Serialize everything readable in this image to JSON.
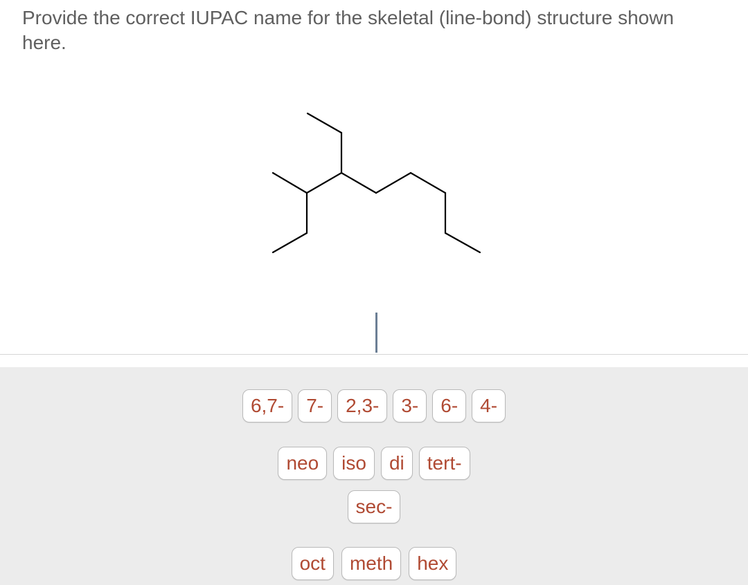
{
  "question": {
    "text": "Provide the correct IUPAC name for the skeletal (line-bond) structure shown here."
  },
  "structure": {
    "description": "skeletal line-bond structure of a branched alkane",
    "bond_color": "#000000"
  },
  "answer": {
    "value": ""
  },
  "tiles": {
    "row1": [
      {
        "label": "6,7-"
      },
      {
        "label": "7-"
      },
      {
        "label": "2,3-"
      },
      {
        "label": "3-"
      },
      {
        "label": "6-"
      },
      {
        "label": "4-"
      }
    ],
    "row2": [
      {
        "label": "neo"
      },
      {
        "label": "iso"
      },
      {
        "label": "di"
      },
      {
        "label": "tert-"
      }
    ],
    "row3": [
      {
        "label": "sec-"
      }
    ],
    "row4": [
      {
        "label": "oct"
      },
      {
        "label": "meth"
      },
      {
        "label": "hex"
      }
    ]
  },
  "colors": {
    "tile_text": "#b04a33",
    "tray_background": "#ececec",
    "question_text": "#5f5f5f",
    "cursor": "#6c7f95"
  }
}
